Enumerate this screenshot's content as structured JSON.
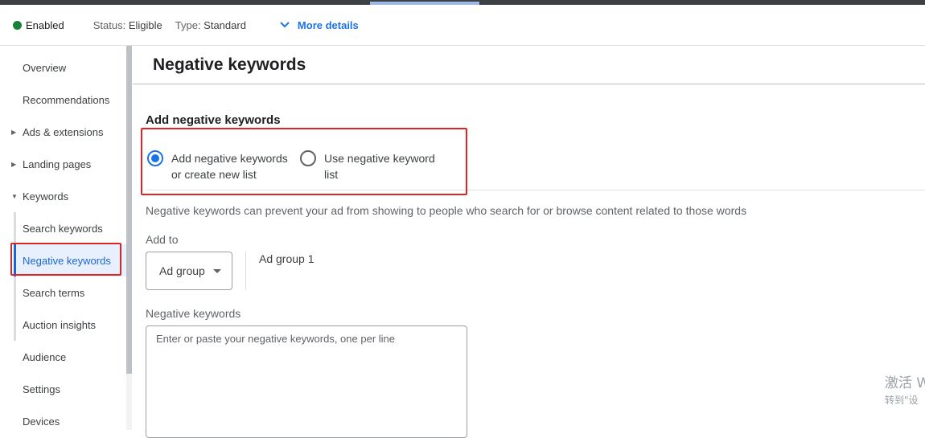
{
  "status_bar": {
    "enabled": "Enabled",
    "status_label": "Status:",
    "status_value": "Eligible",
    "type_label": "Type:",
    "type_value": "Standard",
    "more_details": "More details"
  },
  "sidebar": {
    "items": [
      {
        "label": "Overview"
      },
      {
        "label": "Recommendations"
      },
      {
        "label": "Ads & extensions"
      },
      {
        "label": "Landing pages"
      },
      {
        "label": "Keywords"
      },
      {
        "label": "Search keywords"
      },
      {
        "label": "Negative keywords"
      },
      {
        "label": "Search terms"
      },
      {
        "label": "Auction insights"
      },
      {
        "label": "Audience"
      },
      {
        "label": "Settings"
      },
      {
        "label": "Devices"
      }
    ],
    "active": "Negative keywords"
  },
  "main": {
    "title": "Negative keywords",
    "section_title": "Add negative keywords",
    "options": [
      {
        "label": "Add negative keywords or create new list",
        "selected": true
      },
      {
        "label": "Use negative keyword list",
        "selected": false
      }
    ],
    "description": "Negative keywords can prevent your ad from showing to people who search for or browse content related to those words",
    "add_to_label": "Add to",
    "add_to_select": "Ad group",
    "add_to_value": "Ad group 1",
    "negative_keywords_label": "Negative keywords",
    "negative_keywords_placeholder": "Enter or paste your negative keywords, one per line"
  },
  "watermark": {
    "line1": "激活 W",
    "line2": "转到\"设"
  },
  "colors": {
    "accent": "#1a73e8",
    "enabled_dot": "#188038",
    "highlight_box": "#e02424"
  }
}
